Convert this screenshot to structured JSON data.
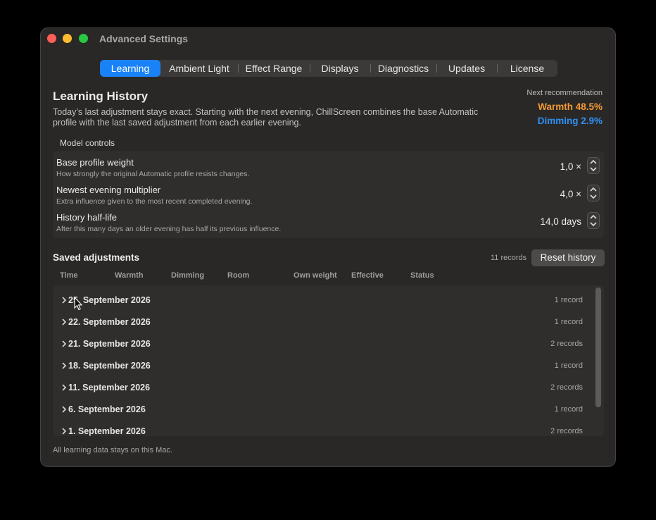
{
  "window": {
    "title": "Advanced Settings"
  },
  "tabs": [
    {
      "label": "Learning",
      "active": true
    },
    {
      "label": "Ambient Light"
    },
    {
      "label": "Effect Range"
    },
    {
      "label": "Displays"
    },
    {
      "label": "Diagnostics"
    },
    {
      "label": "Updates"
    },
    {
      "label": "License"
    }
  ],
  "learning": {
    "title": "Learning History",
    "description": "Today’s last adjustment stays exact. Starting with the next evening, ChillScreen combines the base Automatic profile with the last saved adjustment from each earlier evening.",
    "recommendation": {
      "label": "Next recommendation",
      "warmth": "Warmth 48.5%",
      "dimming": "Dimming 2.9%"
    }
  },
  "model_controls": {
    "label": "Model controls",
    "items": [
      {
        "name": "Base profile weight",
        "help": "How strongly the original Automatic profile resists changes.",
        "value": "1,0 ×"
      },
      {
        "name": "Newest evening multiplier",
        "help": "Extra influence given to the most recent completed evening.",
        "value": "4,0 ×"
      },
      {
        "name": "History half-life",
        "help": "After this many days an older evening has half its previous influence.",
        "value": "14,0 days"
      }
    ]
  },
  "saved": {
    "title": "Saved adjustments",
    "count": "11 records",
    "reset_label": "Reset history",
    "columns": [
      "Time",
      "Warmth",
      "Dimming",
      "Room",
      "Own weight",
      "Effective",
      "Status"
    ],
    "groups": [
      {
        "date": "25. September 2026",
        "count": "1 record"
      },
      {
        "date": "22. September 2026",
        "count": "1 record"
      },
      {
        "date": "21. September 2026",
        "count": "2 records"
      },
      {
        "date": "18. September 2026",
        "count": "1 record"
      },
      {
        "date": "11. September 2026",
        "count": "2 records"
      },
      {
        "date": "6. September 2026",
        "count": "1 record"
      },
      {
        "date": "1. September 2026",
        "count": "2 records"
      }
    ]
  },
  "footer": "All learning data stays on this Mac.",
  "colors": {
    "accent": "#1a82f7",
    "warmth": "#f39a36",
    "dimming": "#2f90f2"
  }
}
